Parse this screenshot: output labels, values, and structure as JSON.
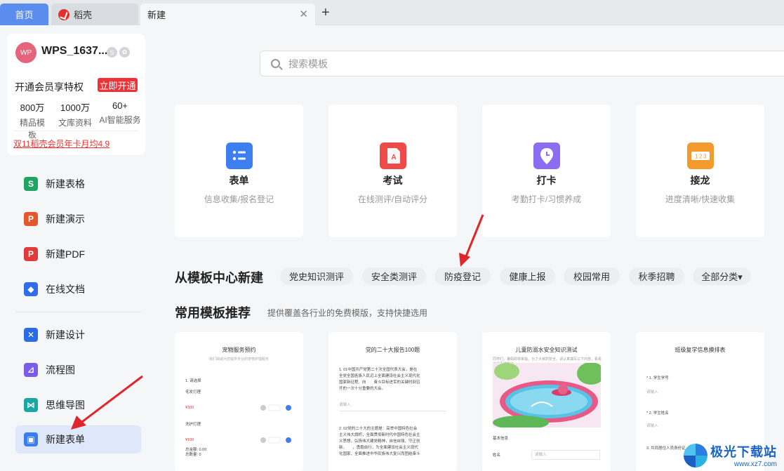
{
  "tabs": {
    "home": "首页",
    "daoke": "稻壳",
    "new": "新建",
    "close": "✕",
    "add": "+"
  },
  "user": {
    "avatar": "WP",
    "name": "WPS_1637...",
    "badge1": "S",
    "badge2": "✿",
    "vip_text": "开通会员享特权",
    "vip_button": "立即开通",
    "stats": [
      {
        "num": "800万",
        "label": "精品模板"
      },
      {
        "num": "1000万",
        "label": "文库资料"
      },
      {
        "num": "60+",
        "label": "AI智能服务"
      }
    ],
    "promo": "双11稻壳会员年卡月均4.9"
  },
  "nav": [
    {
      "label": "新建表格",
      "icon": "spreadsheet-icon",
      "color": "#1fa463",
      "glyph": "S"
    },
    {
      "label": "新建演示",
      "icon": "presentation-icon",
      "color": "#e4592b",
      "glyph": "P"
    },
    {
      "label": "新建PDF",
      "icon": "pdf-icon",
      "color": "#e2393d",
      "glyph": "P"
    },
    {
      "label": "在线文档",
      "icon": "online-doc-icon",
      "color": "#2f6ee8",
      "glyph": "◆"
    },
    {
      "label": "新建设计",
      "icon": "design-icon",
      "color": "#2b6be8",
      "glyph": "✕"
    },
    {
      "label": "流程图",
      "icon": "flowchart-icon",
      "color": "#7b5ce6",
      "glyph": "⊿"
    },
    {
      "label": "思维导图",
      "icon": "mindmap-icon",
      "color": "#18a7a1",
      "glyph": "⋈"
    },
    {
      "label": "新建表单",
      "icon": "form-icon",
      "color": "#3a7df0",
      "glyph": "▣"
    }
  ],
  "search": {
    "placeholder": "搜索模板"
  },
  "cards": [
    {
      "title": "表单",
      "sub": "信息收集/报名登记",
      "color": "#3d7ff0"
    },
    {
      "title": "考试",
      "sub": "在线测评/自动评分",
      "color": "#ee4a4a"
    },
    {
      "title": "打卡",
      "sub": "考勤打卡/习惯养成",
      "color": "#8c6cf0"
    },
    {
      "title": "接龙",
      "sub": "进度清晰/快速收集",
      "color": "#f39a2e"
    }
  ],
  "section1": {
    "title": "从模板中心新建",
    "chips": [
      "党史知识测评",
      "安全类测评",
      "防疫登记",
      "健康上报",
      "校园常用",
      "秋季招聘",
      "全部分类▾"
    ]
  },
  "section2": {
    "title": "常用模板推荐",
    "desc": "提供覆盖各行业的免费模版，支持快捷选用"
  },
  "templates": [
    {
      "title": "宠物服务预约",
      "sub": "我们竭诚为您提供专业的宠物护理服务",
      "lines": [
        "1. 请选择",
        "毛发打理",
        "¥300",
        "洗护打理",
        "¥100",
        "总金额: 0.00",
        "总数量: 0"
      ]
    },
    {
      "title": "党的二十大报告100题",
      "lines": [
        "1. 01中国共产党第二十次全国代表大会，是在",
        "全党全国各族人民迈上全面建设社会主义现代化",
        "国家新征程、向　　奋斗目标进军的关键时刻召",
        "开的一次十分重要的大会。",
        "请输入",
        "2. 02党的二十大的主题是：高举中国特色社会",
        "主义伟大旗帜，全面贯彻新时代中国特色社会主",
        "义思想，弘扬伟大建党精神，自信自强、守正创",
        "新，　　，勇毅前行，为全面建设社会主义现代",
        "化国家、全面推进中华民族伟大复兴而团结奋斗"
      ]
    },
    {
      "title": "儿童防溺水安全知识测试",
      "sub": "同学们，暑假即将来临，为了大家的安全，请认真填写以下内容，看看你是否掌握了",
      "lines": [
        "基本信息",
        "姓名",
        "请输入"
      ]
    },
    {
      "title": "班级复学信息摸排表",
      "lines": [
        "* 1. 学生学号",
        "请输入",
        "* 2. 学生姓名",
        "请输入",
        "3. 共同居住人员身份证"
      ]
    }
  ],
  "watermark": {
    "name": "极光下载站",
    "url": "www.xz7.com"
  }
}
